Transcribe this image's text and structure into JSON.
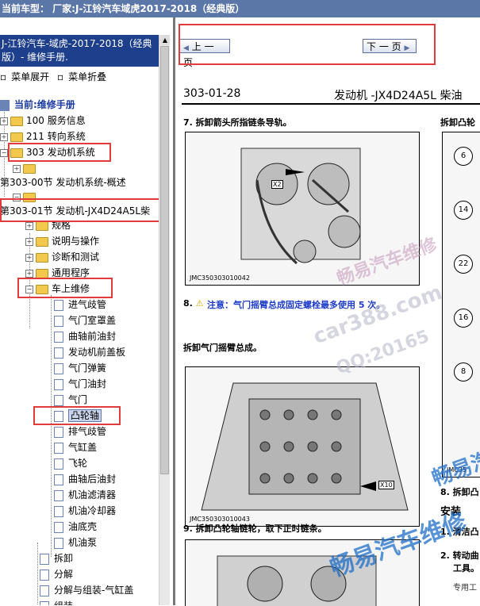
{
  "title_bar": {
    "text": "当前车型：  厂家:J-江铃汽车域虎2017-2018（经典版）"
  },
  "sidebar": {
    "header": "J-江铃汽车-域虎-2017-2018（经典版）- 维修手册.",
    "controls": {
      "expand": "菜单展开",
      "collapse": "菜单折叠"
    },
    "current": "当前:维修手册",
    "items": [
      {
        "label": "100 服务信息"
      },
      {
        "label": "211 转向系统"
      },
      {
        "label": "303 发动机系统"
      },
      {
        "label": ""
      },
      {
        "label": "第303-00节 发动机系统-概述"
      },
      {
        "label": ""
      },
      {
        "label": "第303-01节 发动机-JX4D24A5L柴"
      },
      {
        "label": "规格"
      },
      {
        "label": "说明与操作"
      },
      {
        "label": "诊断和测试"
      },
      {
        "label": "通用程序"
      },
      {
        "label": "车上维修"
      },
      {
        "label": "进气歧管"
      },
      {
        "label": "气门室罩盖"
      },
      {
        "label": "曲轴前油封"
      },
      {
        "label": "发动机前盖板"
      },
      {
        "label": "气门弹簧"
      },
      {
        "label": "气门油封"
      },
      {
        "label": "气门"
      },
      {
        "label": "凸轮轴"
      },
      {
        "label": "排气歧管"
      },
      {
        "label": "气缸盖"
      },
      {
        "label": "飞轮"
      },
      {
        "label": "曲轴后油封"
      },
      {
        "label": "机油滤清器"
      },
      {
        "label": "机油冷却器"
      },
      {
        "label": "油底壳"
      },
      {
        "label": "机油泵"
      },
      {
        "label": "拆卸"
      },
      {
        "label": "分解"
      },
      {
        "label": "分解与组装-气缸盖"
      },
      {
        "label": "组装"
      }
    ]
  },
  "content": {
    "nav": {
      "prev": "上 一 页",
      "next": "下 一 页"
    },
    "page_code": "303-01-28",
    "page_heading": "发动机 -JX4D24A5L 柴油",
    "step7": "7. 拆卸箭头所指链条导轨。",
    "step8_num": "8.",
    "step8_note": "注意：气门摇臂总成固定螺栓最多使用 5 次。",
    "remove_rocker": "拆卸气门摇臂总成。",
    "step9": "9. 拆卸凸轮轴链轮，取下正时链条。",
    "right_top": "拆卸凸轮",
    "right_step8": "8. 拆卸凸",
    "install": "安装",
    "install1": "1. 清洁凸",
    "install2": "2. 转动曲",
    "install2b": "工具。",
    "special": "专用工",
    "diag1_code": "JMC350303010042",
    "diag2_code": "JMC350303010043",
    "diag3_code": "JMC35",
    "numbers": [
      "6",
      "14",
      "22",
      "16",
      "8"
    ],
    "arrow_labels": [
      "X2",
      "X10"
    ],
    "watermarks": [
      "畅易汽车维修",
      "car388.com",
      "QQ:20165",
      "畅易汽车维修",
      "畅易汽车维"
    ]
  }
}
